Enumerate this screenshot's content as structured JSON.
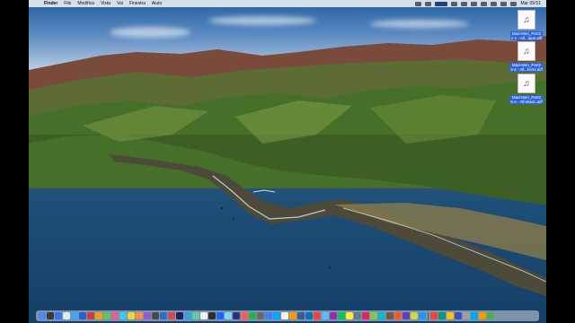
{
  "menubar": {
    "app_name": "Finder",
    "items": [
      "File",
      "Modifica",
      "Vista",
      "Vai",
      "Finestra",
      "Aiuto"
    ],
    "clock": "Mar 09:51"
  },
  "desktop_files": [
    {
      "label_line1": "Mad-Men_Part2",
      "label_line2": "1-1 - All...ique.aiff"
    },
    {
      "label_line1": "Mad-Men_Part2",
      "label_line2": "3-4 - All...fects.aiff"
    },
    {
      "label_line1": "Mad-Men_Part2",
      "label_line2": "5-4 - All Music.aiff"
    }
  ],
  "dock_colors": [
    "#4a8af0",
    "#3a3a3a",
    "#2e7bf0",
    "#e8e8e8",
    "#3da7f5",
    "#2b5fd1",
    "#d43b3b",
    "#f0a020",
    "#5ac85a",
    "#e85c9c",
    "#3cc6f2",
    "#f5d23a",
    "#ff8f3a",
    "#8e5ad6",
    "#4a4a4a",
    "#2f6cd6",
    "#d64a4a",
    "#1f1f70",
    "#3aa0e0",
    "#5ad0a0",
    "#f2f2f2",
    "#2f2f2f",
    "#1a66ff",
    "#8ad0ff",
    "#2f2f80",
    "#ff5a5a",
    "#24b24b",
    "#6a6a6a",
    "#3a83f0",
    "#00a3ff",
    "#f5f5f5",
    "#ff9a00",
    "#3b5998",
    "#0077b5",
    "#ff3d3d",
    "#4fc3f7",
    "#9c27b0",
    "#00c853",
    "#ffeb3b",
    "#607d8b",
    "#e91e63",
    "#8bc34a",
    "#00bcd4",
    "#795548",
    "#ff5722",
    "#673ab7",
    "#cddc39",
    "#2196f3",
    "#f44336",
    "#009688",
    "#ffc107",
    "#3f51b5",
    "#9e9e9e",
    "#03a9f4",
    "#ff9800",
    "#4caf50"
  ]
}
